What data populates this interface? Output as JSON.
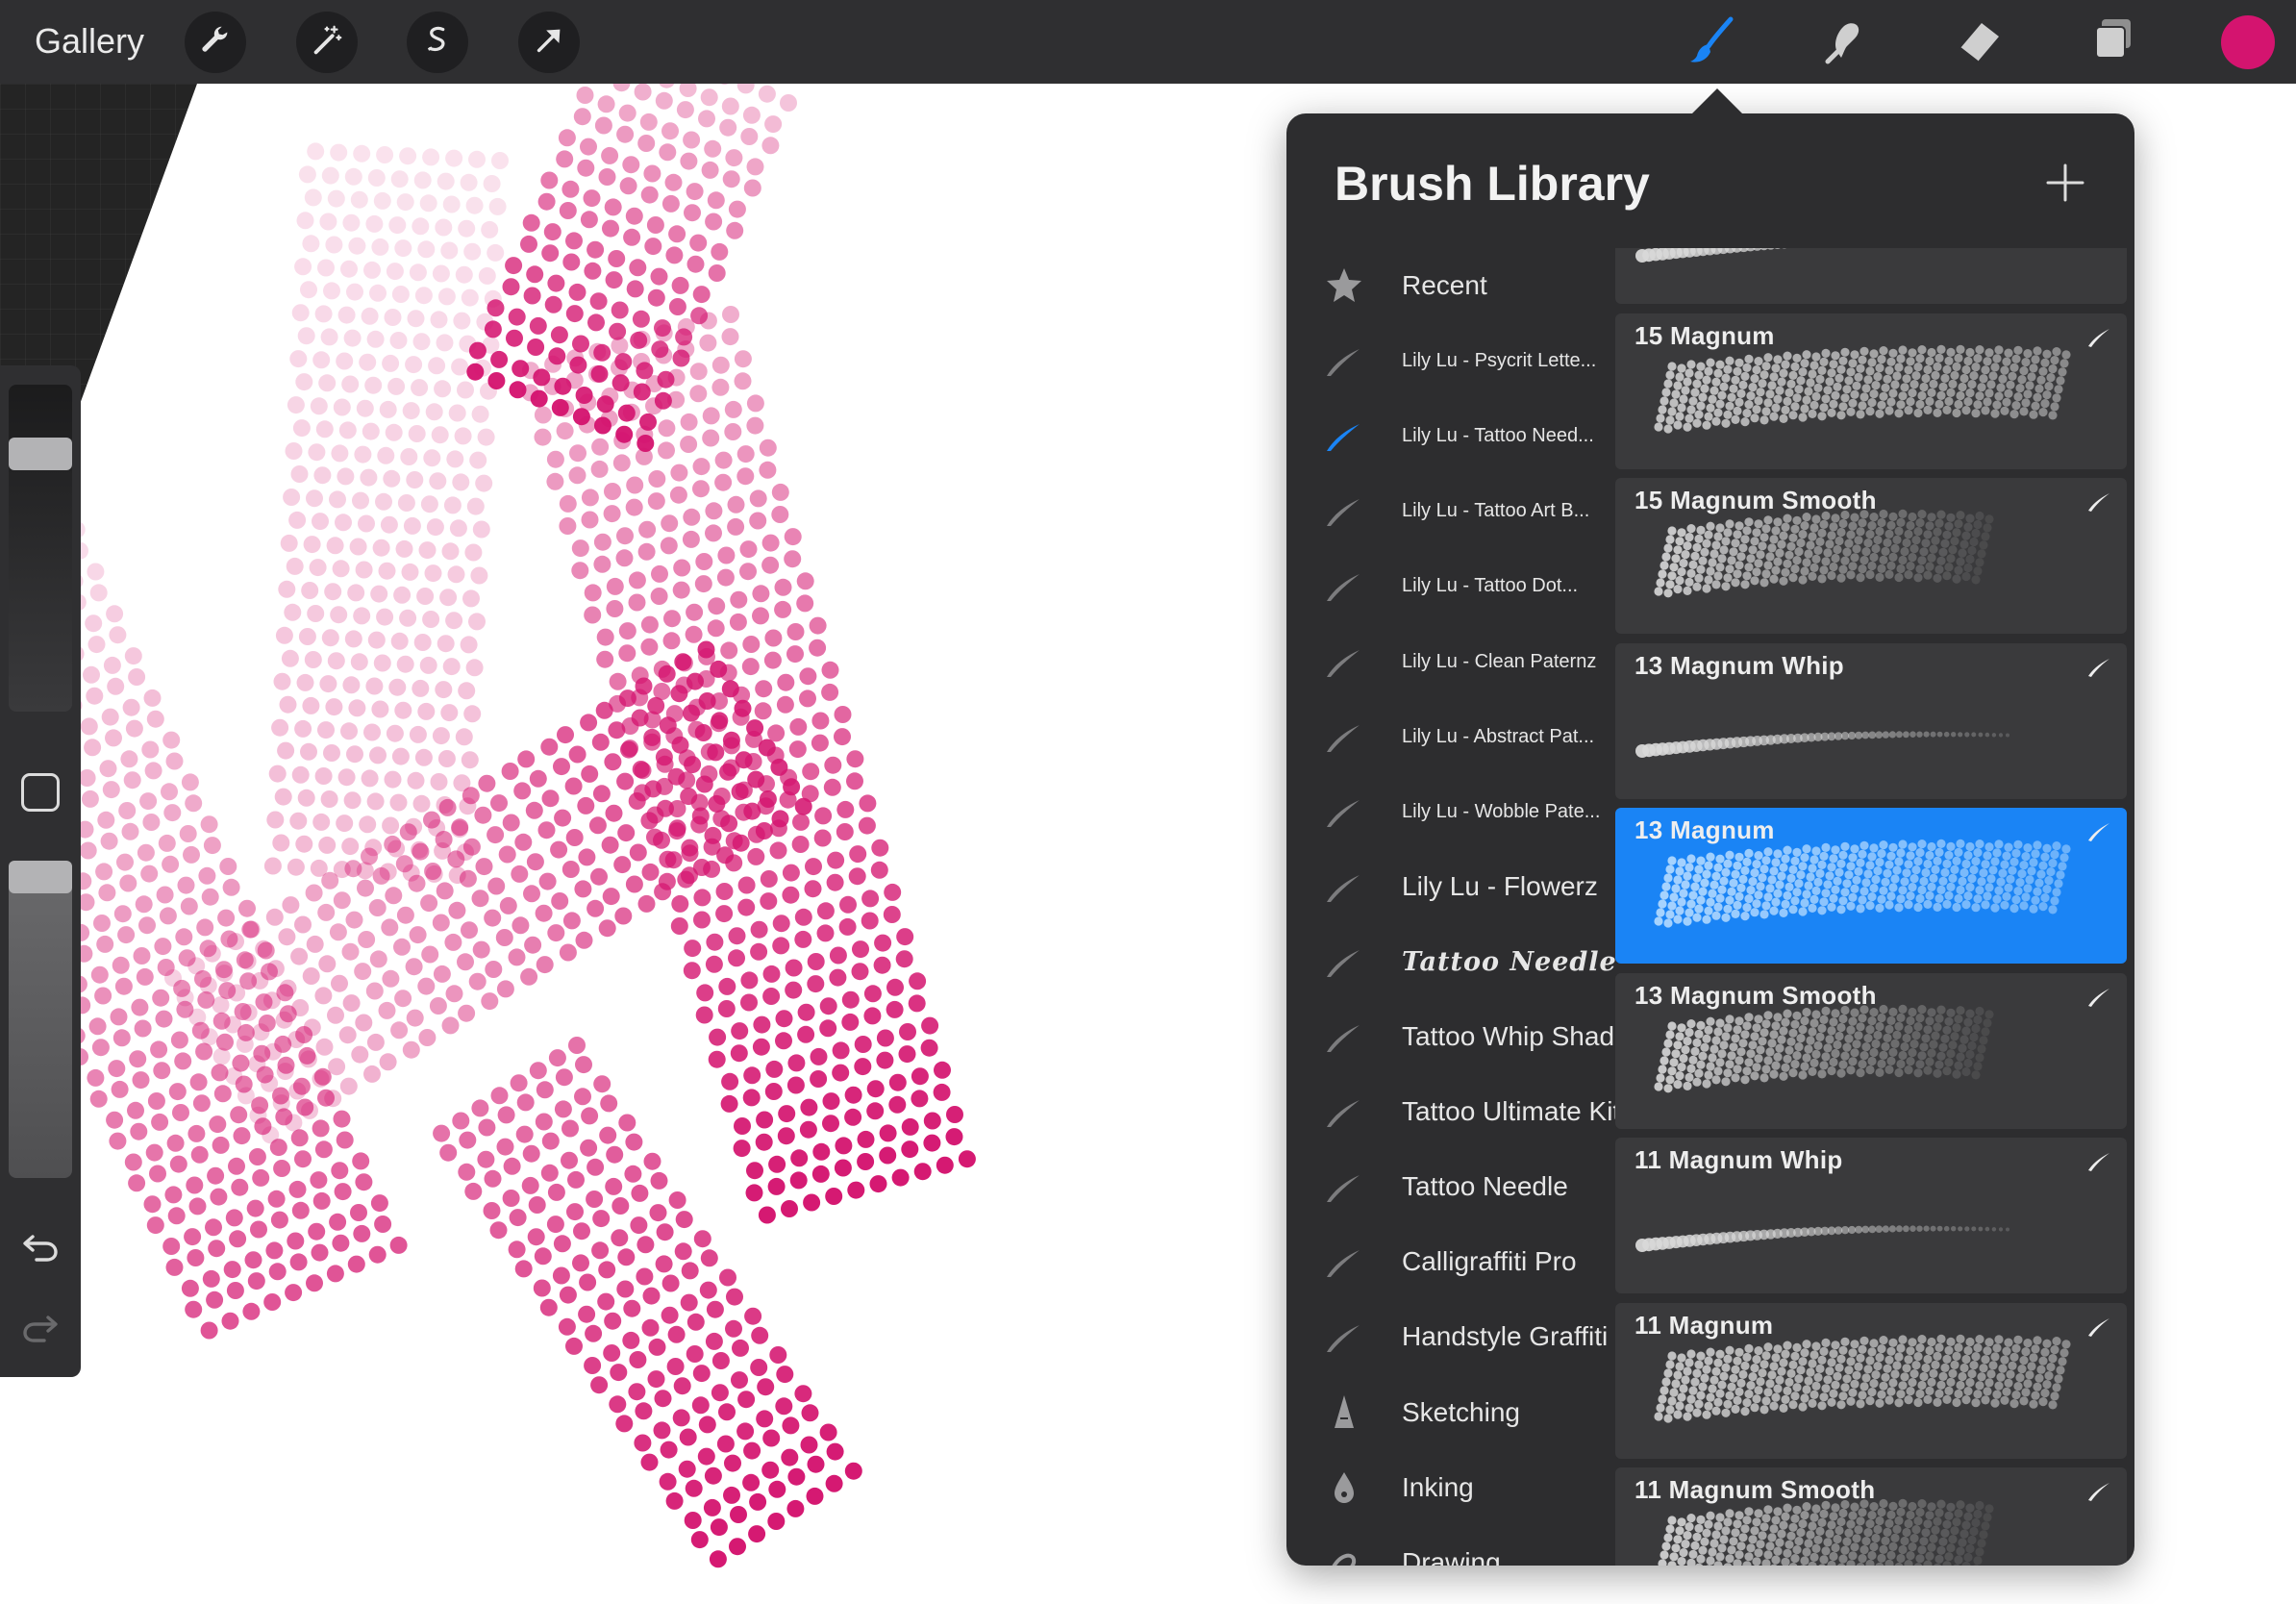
{
  "app": {
    "gallery_label": "Gallery"
  },
  "toolbar_left": [
    {
      "name": "wrench-icon"
    },
    {
      "name": "magic-wand-icon"
    },
    {
      "name": "selection-icon"
    },
    {
      "name": "transform-arrow-icon"
    }
  ],
  "toolbar_right": {
    "active_tool": "brush",
    "tools": [
      "brush-icon",
      "smudge-icon",
      "eraser-icon",
      "layers-icon"
    ],
    "color": "#d4146f"
  },
  "sidebar": {
    "brush_size_level": 0.82,
    "opacity_level": 1.0,
    "icons": [
      "modify-square-icon",
      "undo-icon",
      "redo-icon"
    ]
  },
  "library": {
    "title": "Brush Library",
    "add_icon": "plus-icon",
    "accent_color": "#1a84f5",
    "sets": [
      {
        "label": "Recent",
        "icon": "star-icon",
        "size": "big"
      },
      {
        "label": "Lily Lu - Psycrit Lette...",
        "icon": "brush-stroke-icon",
        "size": "small"
      },
      {
        "label": "Lily Lu - Tattoo Need...",
        "icon": "brush-stroke-icon",
        "size": "small",
        "active": true
      },
      {
        "label": "Lily Lu - Tattoo Art B...",
        "icon": "brush-stroke-icon",
        "size": "small"
      },
      {
        "label": "Lily Lu - Tattoo Dot...",
        "icon": "brush-stroke-icon",
        "size": "small"
      },
      {
        "label": "Lily Lu - Clean Paternz",
        "icon": "brush-stroke-icon",
        "size": "small"
      },
      {
        "label": "Lily Lu - Abstract Pat...",
        "icon": "brush-stroke-icon",
        "size": "small"
      },
      {
        "label": "Lily Lu - Wobble Pate...",
        "icon": "brush-stroke-icon",
        "size": "small"
      },
      {
        "label": "Lily Lu - Flowerz",
        "icon": "brush-stroke-icon",
        "size": "big"
      },
      {
        "label": "Tattoo Needles",
        "icon": "brush-stroke-icon",
        "size": "gothic"
      },
      {
        "label": "Tattoo Whip Shade",
        "icon": "brush-stroke-icon",
        "size": "big"
      },
      {
        "label": "Tattoo Ultimate Kit",
        "icon": "brush-stroke-icon",
        "size": "big"
      },
      {
        "label": "Tattoo Needle",
        "icon": "brush-stroke-icon",
        "size": "big"
      },
      {
        "label": "Calligraffiti Pro",
        "icon": "brush-stroke-icon",
        "size": "big"
      },
      {
        "label": "Handstyle Graffiti",
        "icon": "brush-stroke-icon",
        "size": "big"
      },
      {
        "label": "Sketching",
        "icon": "pencil-tip-icon",
        "size": "big"
      },
      {
        "label": "Inking",
        "icon": "ink-drop-icon",
        "size": "big"
      },
      {
        "label": "Drawing",
        "icon": "drawing-icon",
        "size": "big"
      }
    ],
    "brushes": [
      {
        "label": "",
        "preview": "whip"
      },
      {
        "label": "15 Magnum",
        "preview": "magnum"
      },
      {
        "label": "15 Magnum Smooth",
        "preview": "smooth"
      },
      {
        "label": "13 Magnum Whip",
        "preview": "whip"
      },
      {
        "label": "13 Magnum",
        "preview": "magnum",
        "selected": true
      },
      {
        "label": "13 Magnum Smooth",
        "preview": "smooth"
      },
      {
        "label": "11 Magnum Whip",
        "preview": "whip"
      },
      {
        "label": "11 Magnum",
        "preview": "magnum"
      },
      {
        "label": "11 Magnum Smooth",
        "preview": "smooth"
      }
    ]
  }
}
